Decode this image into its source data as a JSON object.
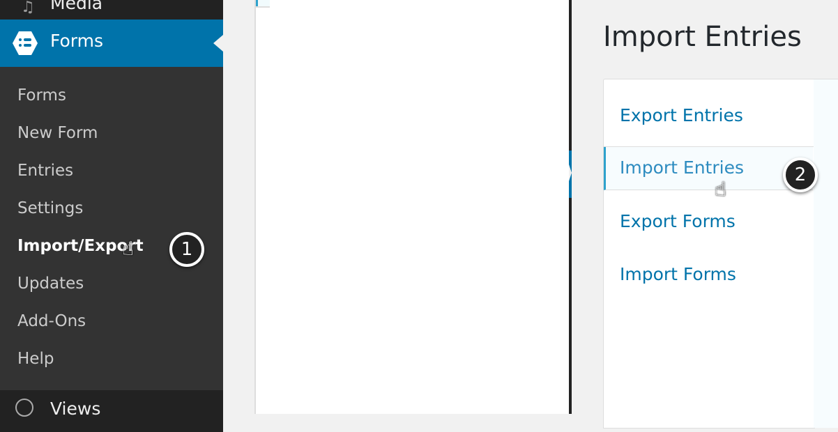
{
  "sidebar": {
    "media_label": "Media",
    "media_icon": "music-notes-icon",
    "forms_label": "Forms",
    "forms_icon": "forms-hexagon-list-icon",
    "submenu": [
      {
        "label": "Forms",
        "current": false
      },
      {
        "label": "New Form",
        "current": false
      },
      {
        "label": "Entries",
        "current": false
      },
      {
        "label": "Settings",
        "current": false
      },
      {
        "label": "Import/Export",
        "current": true
      },
      {
        "label": "Updates",
        "current": false
      },
      {
        "label": "Add-Ons",
        "current": false
      },
      {
        "label": "Help",
        "current": false
      }
    ],
    "views_label": "Views",
    "views_icon": "views-globe-icon"
  },
  "import_page": {
    "title": "Import Entries",
    "tabs": [
      {
        "label": "Export Entries",
        "active": false
      },
      {
        "label": "Import Entries",
        "active": true
      },
      {
        "label": "Export Forms",
        "active": false
      },
      {
        "label": "Import Forms",
        "active": false
      }
    ]
  },
  "annotations": {
    "step1": "1",
    "step2": "2",
    "cursor_glyph": "☝"
  },
  "colors": {
    "admin_sidebar": "#333333",
    "admin_accent": "#0073aa",
    "link": "#0073aa",
    "active_tab_border": "#2ea2cc",
    "page_bg": "#f1f1f1"
  }
}
